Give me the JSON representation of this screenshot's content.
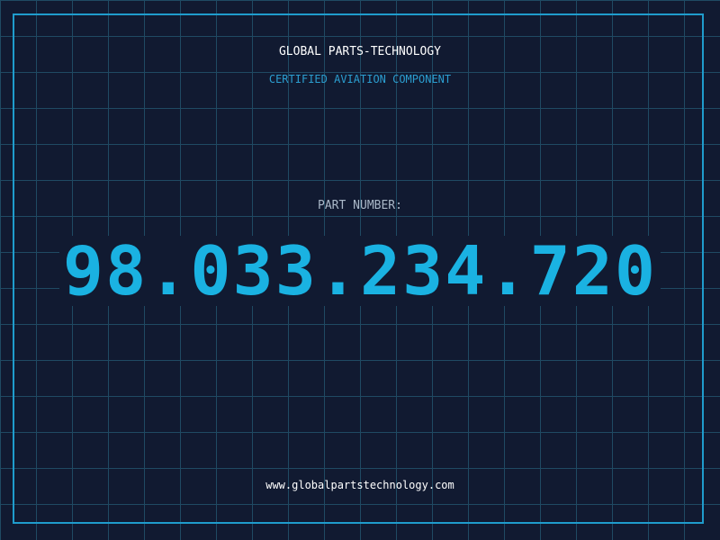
{
  "header": {
    "company": "GLOBAL PARTS-TECHNOLOGY",
    "subtitle": "CERTIFIED AVIATION COMPONENT"
  },
  "part": {
    "label": "PART NUMBER:",
    "number": "98.033.234.720"
  },
  "footer": {
    "website": "www.globalpartstechnology.com"
  },
  "colors": {
    "background": "#111a31",
    "grid": "#1f4a63",
    "accent": "#1ab2e2",
    "frame": "#1f9ccc"
  }
}
